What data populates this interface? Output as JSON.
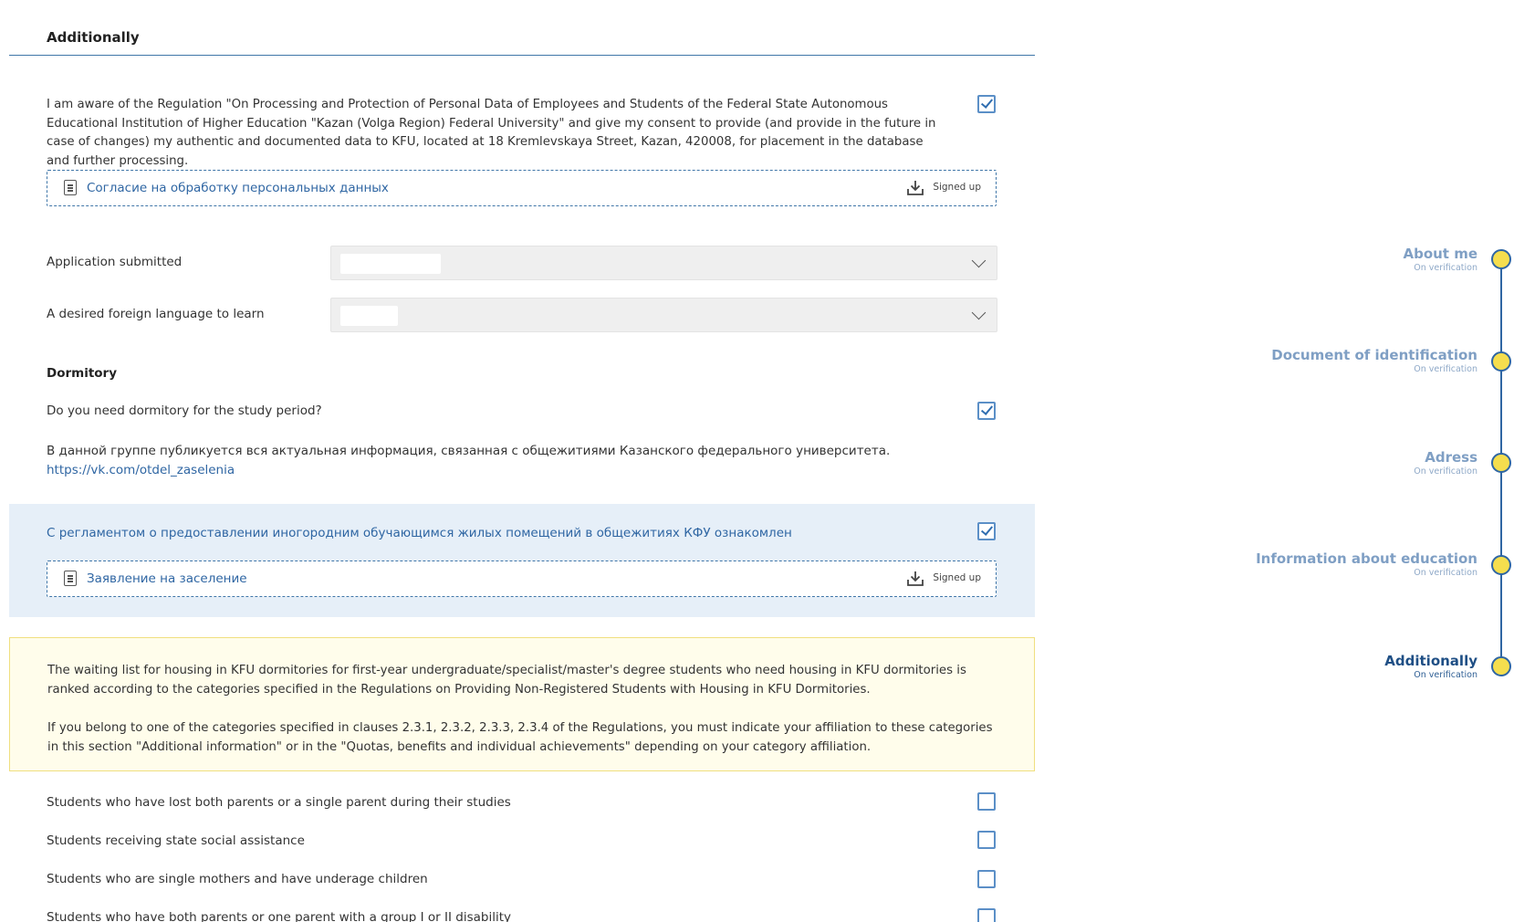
{
  "section": {
    "title": "Additionally"
  },
  "consent": {
    "text": "I am aware of the Regulation \"On Processing and Protection of Personal Data of Employees and Students of the Federal State Autonomous Educational Institution of Higher Education \"Kazan (Volga Region) Federal University\" and give my consent to provide (and provide in the future in case of changes) my authentic and documented data to KFU, located at 18 Kremlevskaya Street, Kazan, 420008, for placement in the database and further processing.",
    "checked": true,
    "document": {
      "label": "Согласие на обработку персональных данных",
      "status": "Signed up",
      "icon": "document-icon"
    }
  },
  "fields": {
    "application_submitted": {
      "label": "Application submitted",
      "value": ""
    },
    "foreign_language": {
      "label": "A desired foreign language to learn",
      "value": ""
    }
  },
  "dormitory": {
    "heading": "Dormitory",
    "need_question": "Do you need dormitory for the study period?",
    "need_checked": true,
    "info_text": "В данной группе публикуется вся актуальная информация, связанная с общежитиями Казанского федерального университета.",
    "info_link": "https://vk.com/otdel_zaselenia",
    "regulation_text": "С регламентом о предоставлении иногородним обучающимся жилых помещений в общежитиях КФУ ознакомлен",
    "regulation_checked": true,
    "document": {
      "label": "Заявление на заселение",
      "status": "Signed up",
      "icon": "document-icon"
    }
  },
  "notice": {
    "paragraph1": "The waiting list for housing in KFU dormitories for first-year undergraduate/specialist/master's degree students who need housing in KFU dormitories is ranked according to the categories specified in the Regulations on Providing Non-Registered Students with Housing in KFU Dormitories.",
    "paragraph2": "If you belong to one of the categories specified in clauses 2.3.1, 2.3.2, 2.3.3, 2.3.4 of the Regulations, you must indicate your affiliation to these categories in this section \"Additional information\" or in the \"Quotas, benefits and individual achievements\" depending on your category affiliation."
  },
  "categories": [
    {
      "label": "Students who have lost both parents or a single parent during their studies",
      "checked": false
    },
    {
      "label": "Students receiving state social assistance",
      "checked": false
    },
    {
      "label": "Students who are single mothers and have underage children",
      "checked": false
    },
    {
      "label": "Students who have both parents or one parent with a group I or II disability",
      "checked": false
    }
  ],
  "timeline": [
    {
      "title": "About me",
      "status": "On verification",
      "active": false
    },
    {
      "title": "Document of identification",
      "status": "On verification",
      "active": false
    },
    {
      "title": "Adress",
      "status": "On verification",
      "active": false
    },
    {
      "title": "Information about education",
      "status": "On verification",
      "active": false
    },
    {
      "title": "Additionally",
      "status": "On verification",
      "active": true
    }
  ],
  "colors": {
    "accent": "#2f66a3",
    "notice_bg": "#fffdeb",
    "panel_bg": "#e6eff8",
    "dot": "#f5de4e"
  }
}
